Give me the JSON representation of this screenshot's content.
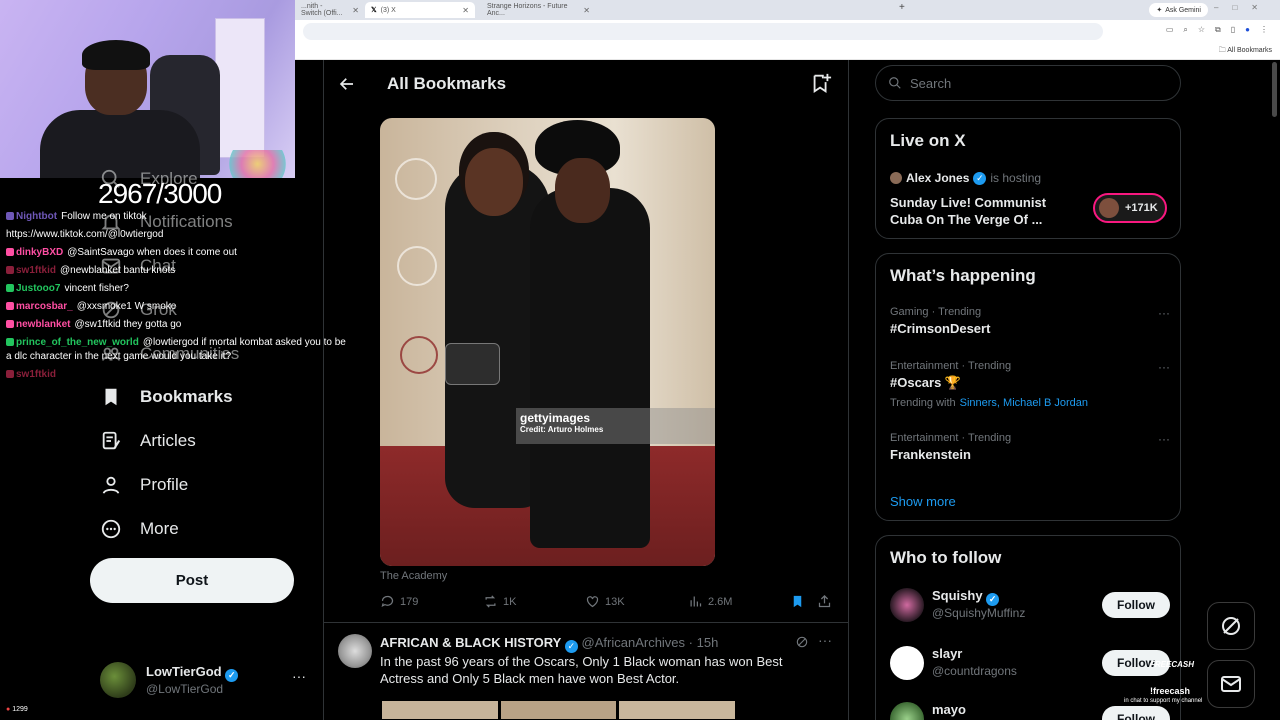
{
  "browser": {
    "tabs": [
      {
        "label": "...nith - Switch (Offi...",
        "active": false
      },
      {
        "label": "(3) X",
        "active": true
      },
      {
        "label": "Strange Horizons - Future Anc...",
        "active": false
      }
    ],
    "ask_gemini": "Ask Gemini",
    "all_bookmarks": "All Bookmarks"
  },
  "stream": {
    "goal": "2967/3000",
    "viewers": "1299",
    "chat": [
      {
        "user": "Nightbot",
        "color": "#6f58b8",
        "msg": "Follow me on tiktok",
        "wrap": false
      },
      {
        "user": "",
        "color": "#ffffff",
        "msg": "https://www.tiktok.com/@l0wtiergod",
        "wrap": false
      },
      {
        "user": "dinkyBXD",
        "color": "#ff4fa3",
        "msg": "@SaintSavago when does it come out",
        "wrap": false
      },
      {
        "user": "sw1ftkid",
        "color": "#8a1f3a",
        "msg": "@newblanket bantu knots",
        "wrap": false
      },
      {
        "user": "Justooo7",
        "color": "#22c55e",
        "msg": "vincent fisher?",
        "wrap": false
      },
      {
        "user": "marcosbar_",
        "color": "#ff4fa3",
        "msg": "@xxsmoke1 W smoke",
        "wrap": false
      },
      {
        "user": "newblanket",
        "color": "#ff4fa3",
        "msg": "@sw1ftkid they gotta go",
        "wrap": false
      },
      {
        "user": "prince_of_the_new_world",
        "color": "#22c55e",
        "msg": "@lowtiergod if mortal kombat asked you to be a dlc character in the next game would you take it?",
        "wrap": true
      },
      {
        "user": "sw1ftkid",
        "color": "#8a1f3a",
        "msg": "",
        "wrap": false
      }
    ]
  },
  "nav": {
    "explore": "Explore",
    "notifications": "Notifications",
    "chat": "Chat",
    "grok": "Grok",
    "communities": "Communities",
    "bookmarks": "Bookmarks",
    "articles": "Articles",
    "profile": "Profile",
    "more": "More",
    "post": "Post"
  },
  "account": {
    "name": "LowTierGod",
    "handle": "@LowTierGod"
  },
  "main": {
    "title": "All Bookmarks",
    "photo": {
      "watermark": "gettyimages",
      "credit": "Credit: Arturo Holmes",
      "source": "The Academy"
    },
    "actions": {
      "replies": "179",
      "reposts": "1K",
      "likes": "13K",
      "views": "2.6M"
    },
    "tweet2": {
      "name": "AFRICAN & BLACK HISTORY",
      "handle": "@AfricanArchives",
      "time": "· 15h",
      "text": "In the past 96 years of the Oscars, Only 1 Black woman has won Best Actress  and Only 5 Black men have won Best Actor."
    }
  },
  "sidebar": {
    "search_placeholder": "Search",
    "live": {
      "title": "Live on X",
      "host": "Alex Jones",
      "is_hosting": "is hosting",
      "space_title": "Sunday Live! Communist Cuba On The Verge Of ...",
      "listeners": "+171K"
    },
    "happening": {
      "title": "What’s happening",
      "trends": [
        {
          "meta": "Gaming · Trending",
          "topic": "#CrimsonDesert",
          "with_label": "",
          "with": ""
        },
        {
          "meta": "Entertainment · Trending",
          "topic": "#Oscars 🏆",
          "with_label": "Trending with",
          "with": "Sinners, Michael B Jordan"
        },
        {
          "meta": "Entertainment · Trending",
          "topic": "Frankenstein",
          "with_label": "",
          "with": ""
        }
      ],
      "show_more": "Show more"
    },
    "who_to_follow": {
      "title": "Who to follow",
      "users": [
        {
          "name": "Squishy",
          "handle": "@SquishyMuffinz",
          "verified": true,
          "button": "Follow"
        },
        {
          "name": "slayr",
          "handle": "@countdragons",
          "verified": false,
          "button": "Follow"
        },
        {
          "name": "mayo",
          "handle": "",
          "verified": false,
          "button": "Follow"
        }
      ]
    }
  },
  "overlay": {
    "freecash": "FREECASH",
    "cmd": "!freecash",
    "hint": "in chat to support my channel"
  }
}
